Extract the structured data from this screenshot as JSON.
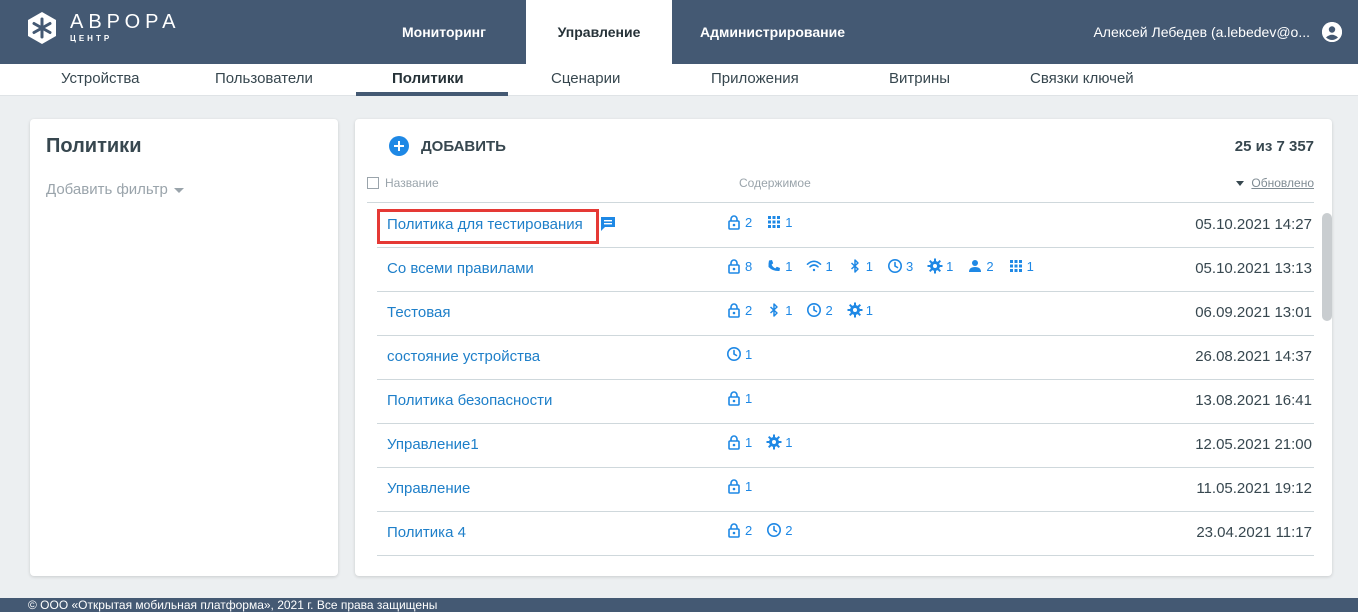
{
  "brand": {
    "title": "АВРОРА",
    "subtitle": "ЦЕНТР"
  },
  "main_tabs": [
    {
      "label": "Мониторинг"
    },
    {
      "label": "Управление",
      "active": true
    },
    {
      "label": "Администрирование"
    }
  ],
  "user": {
    "name": "Алексей Лебедев (a.lebedev@o...",
    "icon": "account-icon"
  },
  "sub_tabs": [
    {
      "label": "Устройства"
    },
    {
      "label": "Пользователи"
    },
    {
      "label": "Политики",
      "active": true
    },
    {
      "label": "Сценарии"
    },
    {
      "label": "Приложения"
    },
    {
      "label": "Витрины"
    },
    {
      "label": "Связки ключей"
    }
  ],
  "sidebar": {
    "title": "Политики",
    "add_filter": "Добавить фильтр"
  },
  "list": {
    "add_label": "ДОБАВИТЬ",
    "count": "25 из 7 357",
    "columns": {
      "name": "Название",
      "content": "Содержимое",
      "updated": "Обновлено"
    },
    "rows": [
      {
        "name": "Политика для тестирования",
        "date": "05.10.2021 14:27",
        "highlighted": true,
        "has_comment": true,
        "content": [
          {
            "icon": "lock",
            "n": "2"
          },
          {
            "icon": "apps",
            "n": "1"
          }
        ]
      },
      {
        "name": "Со всеми правилами",
        "date": "05.10.2021 13:13",
        "content": [
          {
            "icon": "lock",
            "n": "8"
          },
          {
            "icon": "phone",
            "n": "1"
          },
          {
            "icon": "wifi",
            "n": "1"
          },
          {
            "icon": "bluetooth",
            "n": "1"
          },
          {
            "icon": "clock",
            "n": "3"
          },
          {
            "icon": "gear",
            "n": "1"
          },
          {
            "icon": "person",
            "n": "2"
          },
          {
            "icon": "apps",
            "n": "1"
          }
        ]
      },
      {
        "name": "Тестовая",
        "date": "06.09.2021 13:01",
        "content": [
          {
            "icon": "lock",
            "n": "2"
          },
          {
            "icon": "bluetooth",
            "n": "1"
          },
          {
            "icon": "clock",
            "n": "2"
          },
          {
            "icon": "gear",
            "n": "1"
          }
        ]
      },
      {
        "name": "состояние устройства",
        "date": "26.08.2021 14:37",
        "content": [
          {
            "icon": "clock",
            "n": "1"
          }
        ]
      },
      {
        "name": "Политика безопасности",
        "date": "13.08.2021 16:41",
        "content": [
          {
            "icon": "lock",
            "n": "1"
          }
        ]
      },
      {
        "name": "Управление1",
        "date": "12.05.2021 21:00",
        "content": [
          {
            "icon": "lock",
            "n": "1"
          },
          {
            "icon": "gear",
            "n": "1"
          }
        ]
      },
      {
        "name": "Управление",
        "date": "11.05.2021 19:12",
        "content": [
          {
            "icon": "lock",
            "n": "1"
          }
        ]
      },
      {
        "name": "Политика 4",
        "date": "23.04.2021 11:17",
        "content": [
          {
            "icon": "lock",
            "n": "2"
          },
          {
            "icon": "clock",
            "n": "2"
          }
        ]
      }
    ]
  },
  "footer": {
    "text": "© ООО «Открытая мобильная платформа», 2021 г. Все права защищены"
  },
  "colors": {
    "header": "#445973",
    "link": "#1e7fc9",
    "accent": "#1e88e5",
    "highlight": "#e53935"
  }
}
